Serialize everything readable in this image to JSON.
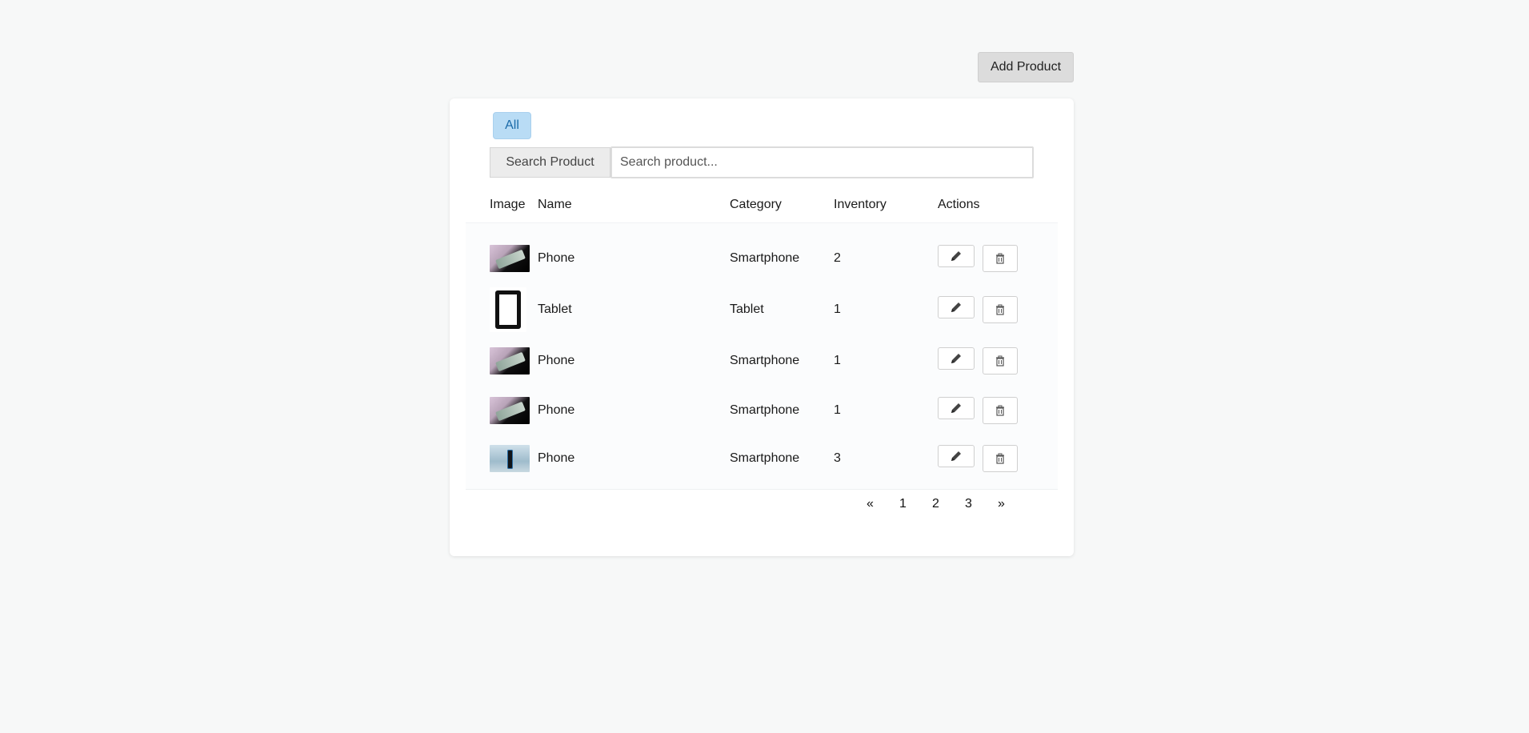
{
  "header": {
    "add_product_label": "Add Product"
  },
  "filters": {
    "tabs": [
      {
        "label": "All",
        "active": true
      }
    ]
  },
  "search": {
    "button_label": "Search Product",
    "placeholder": "Search product...",
    "value": ""
  },
  "table": {
    "columns": [
      "Image",
      "Name",
      "Category",
      "Inventory",
      "Actions"
    ],
    "rows": [
      {
        "image": "phone-a",
        "name": "Phone",
        "category": "Smartphone",
        "inventory": "2"
      },
      {
        "image": "tablet",
        "name": "Tablet",
        "category": "Tablet",
        "inventory": "1"
      },
      {
        "image": "phone-a",
        "name": "Phone",
        "category": "Smartphone",
        "inventory": "1"
      },
      {
        "image": "phone-a",
        "name": "Phone",
        "category": "Smartphone",
        "inventory": "1"
      },
      {
        "image": "phone-b",
        "name": "Phone",
        "category": "Smartphone",
        "inventory": "3"
      }
    ],
    "row_actions": {
      "edit_icon": "pencil-icon",
      "delete_icon": "trash-icon"
    }
  },
  "pagination": {
    "prev": "«",
    "pages": [
      "1",
      "2",
      "3"
    ],
    "next": "»"
  },
  "colors": {
    "background": "#f7f8f8",
    "tab_active_bg": "#b9dcf5",
    "tab_active_text": "#1a6aa8"
  }
}
